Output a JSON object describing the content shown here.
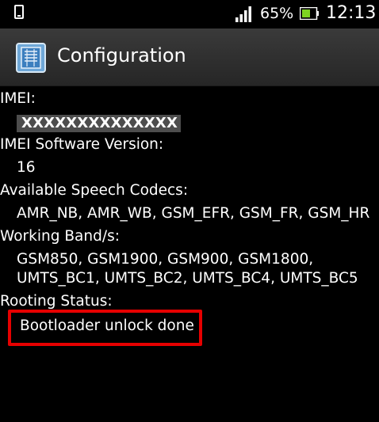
{
  "status_bar": {
    "battery_percent": "65%",
    "time": "12:13",
    "icons": [
      "phone-icon",
      "signal-icon",
      "battery-icon"
    ]
  },
  "title_bar": {
    "title": "Configuration",
    "app_icon": "configuration-app-icon"
  },
  "fields": {
    "imei_label": "IMEI:",
    "imei_value": "XXXXXXXXXXXXXX",
    "imei_sv_label": "IMEI Software Version:",
    "imei_sv_value": "16",
    "codecs_label": "Available Speech Codecs:",
    "codecs_value": "AMR_NB, AMR_WB, GSM_EFR, GSM_FR, GSM_HR",
    "bands_label": "Working Band/s:",
    "bands_line1": "GSM850, GSM1900, GSM900, GSM1800,",
    "bands_line2": "UMTS_BC1, UMTS_BC2, UMTS_BC4, UMTS_BC5",
    "rooting_label": "Rooting Status:",
    "rooting_value": "Bootloader unlock done"
  },
  "colors": {
    "background": "#000000",
    "text": "#ffffff",
    "highlight_border": "#e60000",
    "battery_fill": "#7ed321",
    "title_bar": "#2e2e2e"
  }
}
